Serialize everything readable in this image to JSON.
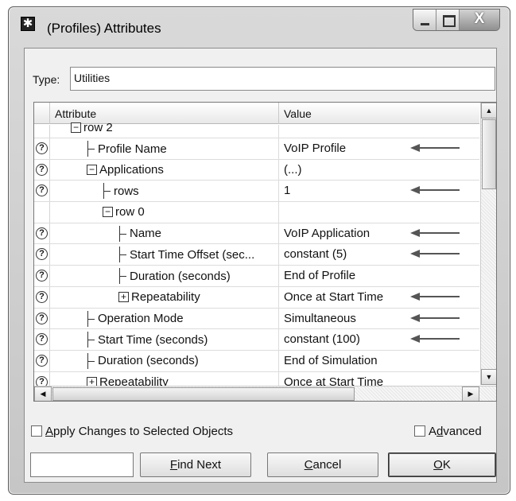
{
  "window": {
    "title": "(Profiles) Attributes"
  },
  "type": {
    "label": "Type:",
    "value": "Utilities"
  },
  "grid": {
    "columns": {
      "attribute": "Attribute",
      "value": "Value"
    },
    "rows": [
      {
        "label": "row 2",
        "value": "",
        "indent": 1,
        "node": "collapse",
        "help": false,
        "arrow": false,
        "partial": true
      },
      {
        "label": "Profile Name",
        "value": "VoIP Profile",
        "indent": 2,
        "node": "leaf",
        "help": true,
        "arrow": true
      },
      {
        "label": "Applications",
        "value": "(...)",
        "indent": 2,
        "node": "collapse",
        "help": true,
        "arrow": false
      },
      {
        "label": "rows",
        "value": "1",
        "indent": 3,
        "node": "leaf",
        "help": true,
        "arrow": true
      },
      {
        "label": "row 0",
        "value": "",
        "indent": 3,
        "node": "collapse",
        "help": false,
        "arrow": false
      },
      {
        "label": "Name",
        "value": "VoIP Application",
        "indent": 4,
        "node": "leaf",
        "help": true,
        "arrow": true
      },
      {
        "label": "Start Time Offset (sec...",
        "value": "constant (5)",
        "indent": 4,
        "node": "leaf",
        "help": true,
        "arrow": true
      },
      {
        "label": "Duration (seconds)",
        "value": "End of Profile",
        "indent": 4,
        "node": "leaf",
        "help": true,
        "arrow": false
      },
      {
        "label": "Repeatability",
        "value": "Once at Start Time",
        "indent": 4,
        "node": "expand",
        "help": true,
        "arrow": true
      },
      {
        "label": "Operation Mode",
        "value": "Simultaneous",
        "indent": 2,
        "node": "leaf",
        "help": true,
        "arrow": true
      },
      {
        "label": "Start Time (seconds)",
        "value": "constant (100)",
        "indent": 2,
        "node": "leaf",
        "help": true,
        "arrow": true
      },
      {
        "label": "Duration (seconds)",
        "value": "End of Simulation",
        "indent": 2,
        "node": "leaf",
        "help": true,
        "arrow": false
      },
      {
        "label": "Repeatability",
        "value": "Once at Start Time",
        "indent": 2,
        "node": "expand",
        "help": true,
        "arrow": false
      }
    ]
  },
  "footer": {
    "apply_label": "Apply Changes to Selected Objects",
    "advanced_label": "Advanced",
    "find_value": "",
    "find_next_label": "Find Next",
    "cancel_label": "Cancel",
    "ok_label": "OK"
  }
}
